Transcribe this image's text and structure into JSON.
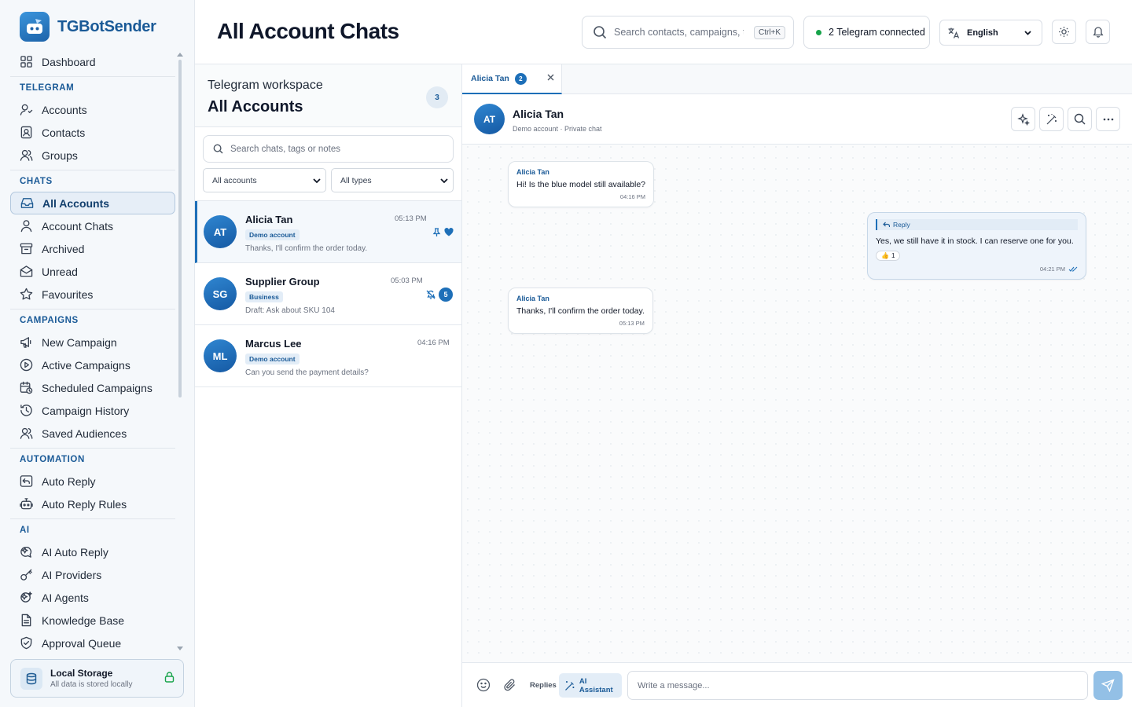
{
  "app": {
    "name": "TGBotSender"
  },
  "sidebar": {
    "items_top": [
      {
        "label": "Dashboard",
        "icon": "dashboard-icon"
      }
    ],
    "sections": [
      {
        "title": "TELEGRAM",
        "items": [
          {
            "label": "Accounts",
            "icon": "accounts-icon"
          },
          {
            "label": "Contacts",
            "icon": "contacts-icon"
          },
          {
            "label": "Groups",
            "icon": "groups-icon"
          }
        ]
      },
      {
        "title": "CHATS",
        "items": [
          {
            "label": "All Accounts",
            "icon": "inbox-icon",
            "active": true
          },
          {
            "label": "Account Chats",
            "icon": "user-icon"
          },
          {
            "label": "Archived",
            "icon": "archive-icon"
          },
          {
            "label": "Unread",
            "icon": "mail-icon"
          },
          {
            "label": "Favourites",
            "icon": "star-icon"
          }
        ]
      },
      {
        "title": "CAMPAIGNS",
        "items": [
          {
            "label": "New Campaign",
            "icon": "megaphone-icon"
          },
          {
            "label": "Active Campaigns",
            "icon": "play-circle-icon"
          },
          {
            "label": "Scheduled Campaigns",
            "icon": "calendar-clock-icon"
          },
          {
            "label": "Campaign History",
            "icon": "history-icon"
          },
          {
            "label": "Saved Audiences",
            "icon": "users-icon"
          }
        ]
      },
      {
        "title": "AUTOMATION",
        "items": [
          {
            "label": "Auto Reply",
            "icon": "reply-box-icon"
          },
          {
            "label": "Auto Reply Rules",
            "icon": "bot-icon"
          }
        ]
      },
      {
        "title": "AI",
        "items": [
          {
            "label": "AI Auto Reply",
            "icon": "ai-reply-icon"
          },
          {
            "label": "AI Providers",
            "icon": "key-icon"
          },
          {
            "label": "AI Agents",
            "icon": "ai-agent-icon"
          },
          {
            "label": "Knowledge Base",
            "icon": "document-icon"
          },
          {
            "label": "Approval Queue",
            "icon": "shield-check-icon"
          }
        ]
      }
    ],
    "storage": {
      "title": "Local Storage",
      "subtitle": "All data is stored locally"
    }
  },
  "header": {
    "title": "All Account Chats",
    "search_placeholder": "Search contacts, campaigns, t...",
    "search_shortcut": "Ctrl+K",
    "telegram_status": "2 Telegram connected",
    "language": "English"
  },
  "chat_list": {
    "kicker": "Telegram workspace",
    "title": "All Accounts",
    "count": "3",
    "search_placeholder": "Search chats, tags or notes",
    "filter_account": "All accounts",
    "filter_type": "All types",
    "chats": [
      {
        "initials": "AT",
        "name": "Alicia Tan",
        "time": "05:13 PM",
        "tag": "Demo account",
        "preview": "Thanks, I'll confirm the order today.",
        "selected": true,
        "pinned": true,
        "favourite": true
      },
      {
        "initials": "SG",
        "name": "Supplier Group",
        "time": "05:03 PM",
        "tag": "Business",
        "preview": "Draft: Ask about SKU 104",
        "muted": true,
        "unread": "5"
      },
      {
        "initials": "ML",
        "name": "Marcus Lee",
        "time": "04:16 PM",
        "tag": "Demo account",
        "preview": "Can you send the payment details?"
      }
    ]
  },
  "conversation": {
    "tab": {
      "label": "Alicia Tan",
      "badge": "2"
    },
    "contact": {
      "initials": "AT",
      "name": "Alicia Tan",
      "subtitle": "Demo account · Private chat"
    },
    "messages": [
      {
        "direction": "in",
        "sender": "Alicia Tan",
        "text": "Hi! Is the blue model still available?",
        "time": "04:16 PM"
      },
      {
        "direction": "out",
        "reply_label": "Reply",
        "text": "Yes, we still have it in stock. I can reserve one for you.",
        "reaction": "👍",
        "reaction_count": "1",
        "time": "04:21 PM"
      },
      {
        "direction": "in",
        "sender": "Alicia Tan",
        "text": "Thanks, I'll confirm the order today.",
        "time": "05:13 PM"
      }
    ],
    "composer": {
      "replies_label": "Replies",
      "ai_label": "AI Assistant",
      "placeholder": "Write a message..."
    }
  }
}
